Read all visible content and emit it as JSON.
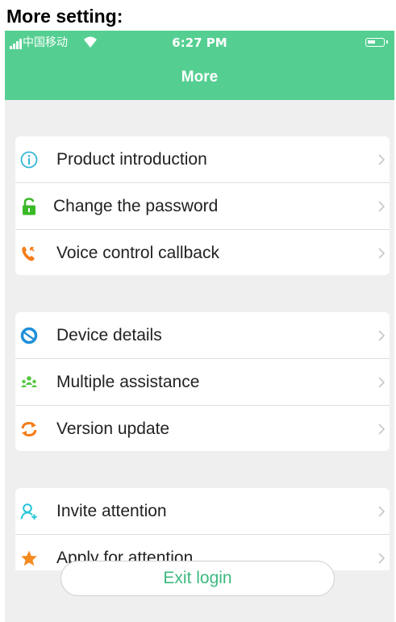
{
  "heading": "More setting:",
  "status_bar": {
    "carrier": "中国移动",
    "time": "6:27 PM"
  },
  "nav": {
    "title": "More"
  },
  "groups": [
    {
      "items": [
        {
          "label": "Product introduction",
          "icon": "info-circle-icon",
          "color": "#34b7d7"
        },
        {
          "label": "Change the password",
          "icon": "lock-icon",
          "color": "#3bba28"
        },
        {
          "label": "Voice control callback",
          "icon": "phone-callback-icon",
          "color": "#f57d19"
        }
      ]
    },
    {
      "items": [
        {
          "label": "Device details",
          "icon": "device-ring-icon",
          "color": "#1f8fd8"
        },
        {
          "label": "Multiple assistance",
          "icon": "group-people-icon",
          "color": "#56c63f"
        },
        {
          "label": "Version update",
          "icon": "refresh-icon",
          "color": "#f57d19"
        }
      ]
    },
    {
      "items": [
        {
          "label": "Invite attention",
          "icon": "add-person-icon",
          "color": "#27c6d8"
        },
        {
          "label": "Apply for attention",
          "icon": "star-icon",
          "color": "#f58a1f"
        }
      ]
    }
  ],
  "exit_button": {
    "label": "Exit login",
    "color": "#3db97f"
  },
  "colors": {
    "header": "#55cf91",
    "background": "#efefef"
  }
}
